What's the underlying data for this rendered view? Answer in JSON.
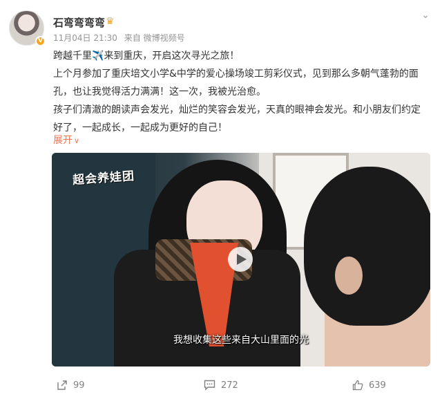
{
  "post": {
    "username": "石弯弯弯弯",
    "badge": "V",
    "date": "11月04日 21:30",
    "source": "来自 微博视频号",
    "more_glyph": "⌄",
    "paragraphs": [
      {
        "before": "跨越千里",
        "icon": "✈️",
        "after": "来到重庆，开启这次寻光之旅！"
      },
      {
        "text": "上个月参加了重庆培文小学&中学的爱心操场竣工剪彩仪式，见到那么多朝气蓬勃的面孔，也让我觉得活力满满！这一次，我被光治愈。"
      },
      {
        "text": "孩子们清澈的朗读声会发光，灿烂的笑容会发光，天真的眼神会发光。和小朋友们约定好了，一起成长，一起成为更好的自己！"
      }
    ],
    "expand_label": "展开"
  },
  "video": {
    "logo_text": "超会养娃团",
    "subtitle": "我想收集这些来自大山里面的光"
  },
  "actions": {
    "share_count": "99",
    "comment_count": "272",
    "like_count": "639"
  },
  "colors": {
    "accent_orange": "#eb7350",
    "badge": "#f5a623",
    "meta_gray": "#939393"
  },
  "icons": {
    "share": "share-icon",
    "comment": "comment-icon",
    "like": "thumbs-up-icon",
    "play": "play-icon",
    "more": "chevron-down-icon",
    "crown": "crown-icon"
  }
}
